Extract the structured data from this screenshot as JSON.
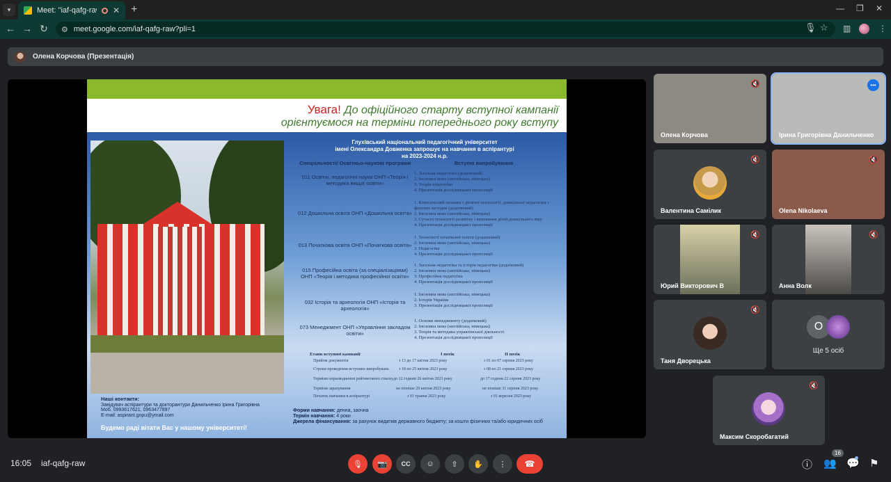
{
  "browser": {
    "tab_title": "Meet: \"iaf-qafg-raw\"",
    "url": "meet.google.com/iaf-qafg-raw?pli=1"
  },
  "meet": {
    "presenter_label": "Олена Корчова (Презентація)",
    "clock": "16:05",
    "meeting_code": "iaf-qafg-raw",
    "people_count": "16",
    "more_people": "Ще 5 осіб",
    "more_initial": "O"
  },
  "participants": [
    {
      "name": "Олена Корчова",
      "muted": true
    },
    {
      "name": "Ірина Григорівна Данильченко",
      "muted": false,
      "speaking": true
    },
    {
      "name": "Валентина Самілик",
      "muted": true
    },
    {
      "name": "Olena Nikolaeva",
      "muted": true
    },
    {
      "name": "Юрий Викторович В",
      "muted": true
    },
    {
      "name": "Анна Волк",
      "muted": true
    },
    {
      "name": "Таня Дворецька",
      "muted": true
    },
    {
      "name": "Максим Скоробагатий",
      "muted": true
    }
  ],
  "slide": {
    "attention": "Увага!",
    "head_line1": "До офіційного старту вступної кампанії",
    "head_line2": "орієнтуємося на терміни попереднього року вступу",
    "title1": "Глухівський національний педагогічний університет",
    "title2": "імені Олександра Довженка запрошує на навчання в аспірантурі",
    "title3": "на 2023-2024 н.р.",
    "col_spec": "Спеціальності/ Освітньо-наукові програми",
    "col_exams": "Вступні випробування",
    "programs": [
      {
        "spec": "011 Освітні, педагогічні науки ОНП «Теорія і методика вищої освіти»",
        "exams": [
          "1. Загальна педагогіка (додатковий)",
          "2. Іноземна мова (англійська, німецька)",
          "3. Теорія педагогіки",
          "4. Презентація дослідницької пропозиції"
        ]
      },
      {
        "spec": "012 Дошкільна освіта ОНП «Дошкільна освіта»",
        "exams": [
          "1. Комплексний екзамен з дитячої психології, дошкільної педагогіки і фахових методик (додатковий)",
          "2. Іноземна мова (англійська, німецька)",
          "3. Сучасні технології розвитку і виховання дітей дошкільного віку",
          "4. Презентація дослідницької пропозиції"
        ]
      },
      {
        "spec": "013 Початкова освіта ОНП «Початкова освіта»",
        "exams": [
          "1. Технології початкової освіти (додатковий)",
          "2. Іноземна мова (англійська, німецька)",
          "3. Педагогіка",
          "4. Презентація дослідницької пропозиції"
        ]
      },
      {
        "spec": "015 Професійна освіта (за спеціалізаціями) ОНП «Теорія і методика професійної освіти»",
        "exams": [
          "1. Загальна педагогіка та історія педагогіки (додатковий)",
          "2. Іноземна мова (англійська, німецька)",
          "3. Професійна педагогіка",
          "4. Презентація дослідницької пропозиції"
        ]
      },
      {
        "spec": "032 Історія та археологія ОНП «Історія та археологія»",
        "exams": [
          "1. Іноземна мова (англійська, німецька)",
          "2. Історія України",
          "3. Презентація дослідницької пропозиції"
        ]
      },
      {
        "spec": "073 Менеджмент ОНП «Управління закладом освіти»",
        "exams": [
          "1. Основи менеджменту (додатковий)",
          "2. Іноземна мова (англійська, німецька)",
          "3. Теорія та методика управлінської діяльності",
          "4. Презентація дослідницької пропозиції"
        ]
      }
    ],
    "stages_header": "Етапи вступної кампанії",
    "stream1": "І потік",
    "stream2": "ІІ потік",
    "stages": [
      {
        "label": "Прийом документів",
        "s1": "з 13 до 17 квітня 2023 року",
        "s2": "з 01 по 07 серпня 2023 року"
      },
      {
        "label": "Строки проведення вступних випробувань",
        "s1": "з 18 по 25 квітня 2023 року",
        "s2": "з 08 по 21 серпня 2023 року"
      },
      {
        "label": "Терміни оприлюднення рейтингового списку",
        "s1": "до 12 години 26 квітня 2023 року",
        "s2": "до 17 години 22 серпня 2023 року"
      },
      {
        "label": "Терміни зарахування",
        "s1": "не пізніше 29 квітня 2023 року",
        "s2": "не пізніше 31 серпня 2023 року"
      },
      {
        "label": "Початок навчання в аспірантурі",
        "s1": "з 01 травня 2023 року",
        "s2": "з 01 вересня 2023 року"
      }
    ],
    "contacts_title": "Наші контакти:",
    "contacts_line1": "Завідувач аспірантури та докторантури Данильченко Ірина Григорівна",
    "contacts_line2": "Моб. 0993617621, 0963477897",
    "contacts_line3": "E-mail: aspirant.gnpu@ymail.com",
    "welcome": "Будемо раді вітати Вас у нашому університеті!",
    "forma_label": "Форми навчання:",
    "forma_value": "денна, заочна",
    "term_label": "Термін навчання:",
    "term_value": "4 роки",
    "fund_label": "Джерела фінансування:",
    "fund_value": "за рахунок видатків державного бюджету; за кошти фізичних та/або юридичних осіб"
  }
}
